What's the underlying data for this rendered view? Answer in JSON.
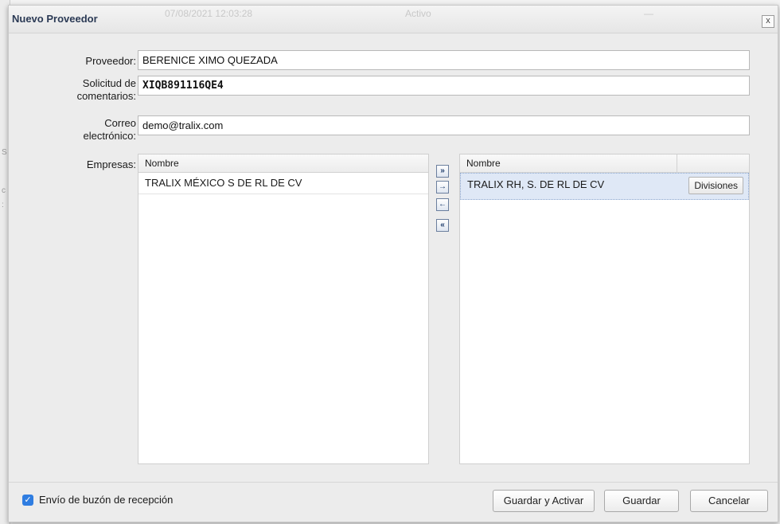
{
  "window": {
    "title": "Nuevo Proveedor",
    "ghost_date": "07/08/2021 12:03:28",
    "ghost_status": "Activo",
    "ghost_dash": "—",
    "close_glyph": "x"
  },
  "form": {
    "proveedor_label": "Proveedor:",
    "proveedor_value": "BERENICE XIMO QUEZADA",
    "solicitud_label_line1": "Solicitud de",
    "solicitud_label_line2": "comentarios:",
    "solicitud_value": "XIQB891116QE4",
    "correo_label_line1": "Correo",
    "correo_label_line2": "electrónico:",
    "correo_value": "demo@tralix.com",
    "empresas_label": "Empresas:"
  },
  "available_grid": {
    "header": "Nombre",
    "rows": [
      "TRALIX MÉXICO S DE RL DE CV"
    ]
  },
  "selected_grid": {
    "header": "Nombre",
    "rows": [
      {
        "name": "TRALIX RH, S. DE RL DE CV",
        "action": "Divisiones"
      }
    ]
  },
  "transfer_buttons": {
    "add_all": "»",
    "add": "→",
    "remove": "←",
    "remove_all": "«"
  },
  "footer": {
    "checkbox_checked": true,
    "checkbox_label": "Envío de buzón de recepción",
    "btn_save_activate": "Guardar y Activar",
    "btn_save": "Guardar",
    "btn_cancel": "Cancelar"
  },
  "colors": {
    "accent": "#2f7de1",
    "selection": "#dfe8f6",
    "title": "#2b3a55"
  }
}
